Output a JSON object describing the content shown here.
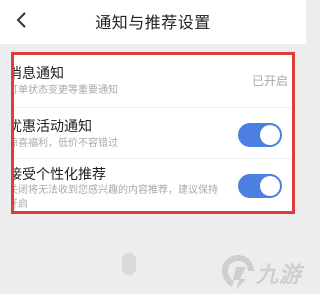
{
  "nav": {
    "title": "通知与推荐设置",
    "back_icon": "chevron-left-icon"
  },
  "settings": [
    {
      "title": "消息通知",
      "description": "订单状态变更等重要通知",
      "status": "已开启"
    },
    {
      "title": "优惠活动通知",
      "description": "惊喜福利，低价不容错过",
      "toggle": "on"
    },
    {
      "title": "接受个性化推荐",
      "description_line1": "关闭将无法收到您感兴趣的内容推荐，建议保持",
      "description_line2": "开启",
      "toggle": "on"
    }
  ],
  "watermark": {
    "text": "九游",
    "logo": "jiuyou-logo-icon"
  },
  "colors": {
    "highlight_border": "#e23b3b",
    "toggle_on": "#4b7fe0",
    "background": "#ededed"
  }
}
